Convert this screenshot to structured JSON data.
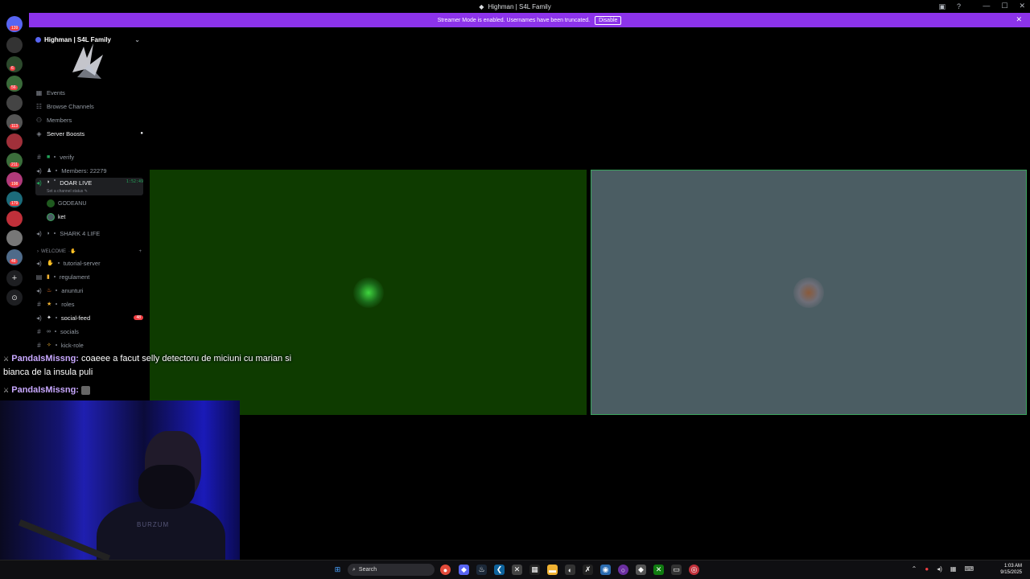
{
  "window": {
    "title": "Highman | S4L Family"
  },
  "banner": {
    "text": "Streamer Mode is enabled. Usernames have been truncated.",
    "disable_label": "Disable"
  },
  "guilds": {
    "badges": [
      "139",
      "6",
      "56",
      "113",
      "211",
      "198",
      "179",
      "48"
    ]
  },
  "server": {
    "name": "Highman | S4L Family",
    "nav": [
      {
        "label": "Events",
        "icon": "calendar-icon"
      },
      {
        "label": "Browse Channels",
        "icon": "browse-icon"
      },
      {
        "label": "Members",
        "icon": "members-icon"
      },
      {
        "label": "Server Boosts",
        "icon": "boost-icon"
      }
    ],
    "channels": {
      "verify": "verify",
      "members": "Members: 22279",
      "doar_live": "DOAR LIVE",
      "doar_live_timer": "1:52:49",
      "status_hint": "Set a channel status",
      "voice_user_1": "GODEANU",
      "voice_user_2": "ket",
      "shark": "SHARK 4 LIFE",
      "category_welcome": "WELCOME",
      "tutorial": "tutorial-server",
      "regulament": "regulament",
      "anunturi": "anunturi",
      "roles": "roles",
      "social_feed": "social-feed",
      "social_feed_badge": "48",
      "socials": "socials",
      "kick_role": "kick-role"
    }
  },
  "chat_overlay": {
    "user1": "PandaIsMissng:",
    "msg1": "coaeee a facut selly detectoru de miciuni cu marian si bianca de la insula puli",
    "user2": "PandaIsMissng:"
  },
  "webcam": {
    "shirt_text": "BURZUM"
  },
  "taskbar": {
    "search_placeholder": "Search",
    "time": "1:03 AM",
    "date": "9/15/2025"
  },
  "colors": {
    "banner": "#8c33ea",
    "tile_left": "#0e3b00",
    "tile_right": "#4b5d63",
    "speaking_border": "#3ba55d"
  }
}
